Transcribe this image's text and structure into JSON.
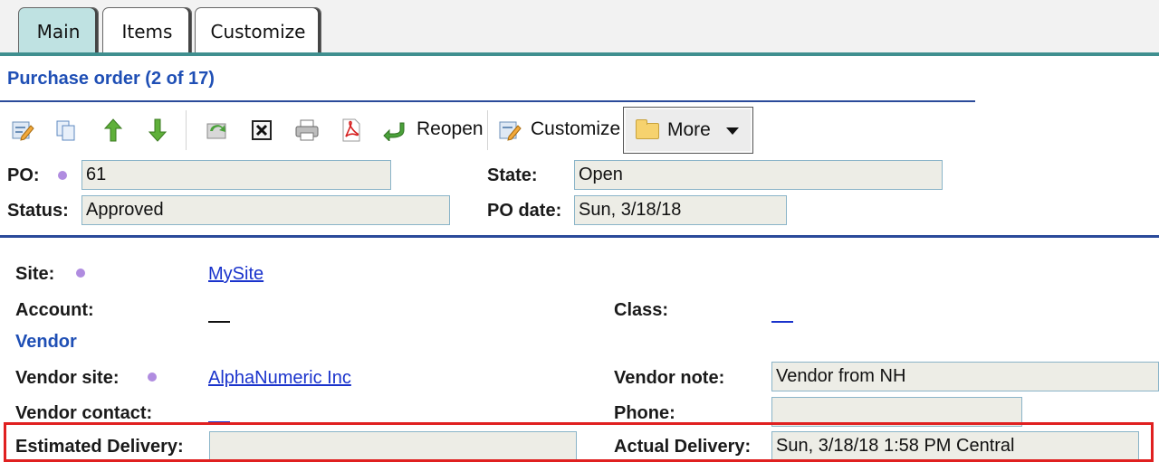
{
  "tabs": [
    {
      "label": "Main",
      "active": true
    },
    {
      "label": "Items",
      "active": false
    },
    {
      "label": "Customize",
      "active": false
    }
  ],
  "title": "Purchase order (2 of 17)",
  "toolbar": {
    "icons": [
      "edit-icon",
      "copy-icon",
      "arrow-up-icon",
      "arrow-down-icon",
      "refresh-icon",
      "delete-icon",
      "print-icon",
      "pdf-icon"
    ],
    "reopen_label": "Reopen",
    "customize_label": "Customize",
    "more_label": "More"
  },
  "header_fields": {
    "po_label": "PO:",
    "po_value": "61",
    "state_label": "State:",
    "state_value": "Open",
    "status_label": "Status:",
    "status_value": "Approved",
    "po_date_label": "PO date:",
    "po_date_value": "Sun, 3/18/18"
  },
  "details": {
    "site_label": "Site:",
    "site_value": "MySite",
    "account_label": "Account:",
    "class_label": "Class:",
    "vendor_section": "Vendor",
    "vendor_site_label": "Vendor site:",
    "vendor_site_value": "AlphaNumeric Inc",
    "vendor_note_label": "Vendor note:",
    "vendor_note_value": "Vendor from NH",
    "vendor_contact_label": "Vendor contact:",
    "phone_label": "Phone:",
    "phone_value": "",
    "estimated_delivery_label": "Estimated Delivery:",
    "estimated_delivery_value": "",
    "actual_delivery_label": "Actual Delivery:",
    "actual_delivery_value": "Sun, 3/18/18 1:58 PM Central"
  },
  "colors": {
    "accent_tab": "#bfe2e2",
    "tab_line": "#3f8f8f",
    "title": "#1f4fb5",
    "link": "#1a33cc",
    "required_dot": "#b08ce0",
    "highlight_box": "#e02020"
  }
}
